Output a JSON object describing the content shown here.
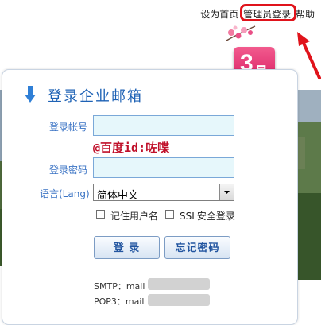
{
  "header": {
    "set_homepage": "设为首页",
    "admin_login": "管理员登录",
    "help": "帮助"
  },
  "badge": {
    "number": "3",
    "unit": "月"
  },
  "login": {
    "title": "登录企业邮箱",
    "account_label": "登录帐号",
    "account_value": "",
    "domain_text": "@百度id:咗喋",
    "password_label": "登录密码",
    "password_value": "",
    "language_label": "语言(Lang)",
    "language_selected": "简体中文",
    "remember_label": "记住用户名",
    "ssl_label": "SSL安全登录",
    "login_button": "登 录",
    "forgot_button": "忘记密码"
  },
  "server_info": {
    "smtp": "SMTP：mail",
    "pop3": "POP3：mail"
  },
  "colors": {
    "accent": "#1e62b5",
    "label": "#3a73c4",
    "highlight": "#e0131b",
    "badge": "#e0306f"
  }
}
